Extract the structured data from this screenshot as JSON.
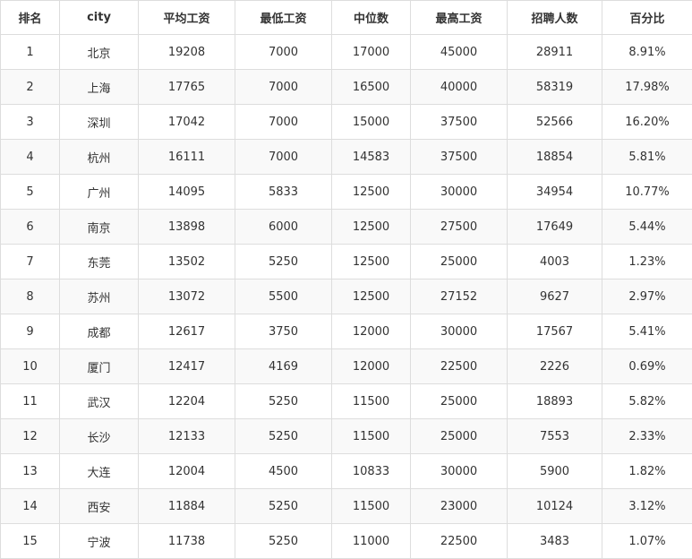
{
  "table": {
    "headers": [
      "排名",
      "city",
      "平均工资",
      "最低工资",
      "中位数",
      "最高工资",
      "招聘人数",
      "百分比"
    ],
    "rows": [
      [
        "1",
        "北京",
        "19208",
        "7000",
        "17000",
        "45000",
        "28911",
        "8.91%"
      ],
      [
        "2",
        "上海",
        "17765",
        "7000",
        "16500",
        "40000",
        "58319",
        "17.98%"
      ],
      [
        "3",
        "深圳",
        "17042",
        "7000",
        "15000",
        "37500",
        "52566",
        "16.20%"
      ],
      [
        "4",
        "杭州",
        "16111",
        "7000",
        "14583",
        "37500",
        "18854",
        "5.81%"
      ],
      [
        "5",
        "广州",
        "14095",
        "5833",
        "12500",
        "30000",
        "34954",
        "10.77%"
      ],
      [
        "6",
        "南京",
        "13898",
        "6000",
        "12500",
        "27500",
        "17649",
        "5.44%"
      ],
      [
        "7",
        "东莞",
        "13502",
        "5250",
        "12500",
        "25000",
        "4003",
        "1.23%"
      ],
      [
        "8",
        "苏州",
        "13072",
        "5500",
        "12500",
        "27152",
        "9627",
        "2.97%"
      ],
      [
        "9",
        "成都",
        "12617",
        "3750",
        "12000",
        "30000",
        "17567",
        "5.41%"
      ],
      [
        "10",
        "厦门",
        "12417",
        "4169",
        "12000",
        "22500",
        "2226",
        "0.69%"
      ],
      [
        "11",
        "武汉",
        "12204",
        "5250",
        "11500",
        "25000",
        "18893",
        "5.82%"
      ],
      [
        "12",
        "长沙",
        "12133",
        "5250",
        "11500",
        "25000",
        "7553",
        "2.33%"
      ],
      [
        "13",
        "大连",
        "12004",
        "4500",
        "10833",
        "30000",
        "5900",
        "1.82%"
      ],
      [
        "14",
        "西安",
        "11884",
        "5250",
        "11500",
        "23000",
        "10124",
        "3.12%"
      ],
      [
        "15",
        "宁波",
        "11738",
        "5250",
        "11000",
        "22500",
        "3483",
        "1.07%"
      ]
    ]
  },
  "colors": {
    "border": "#dddddd",
    "stripe": "#f9f9f9",
    "text": "#333333"
  }
}
